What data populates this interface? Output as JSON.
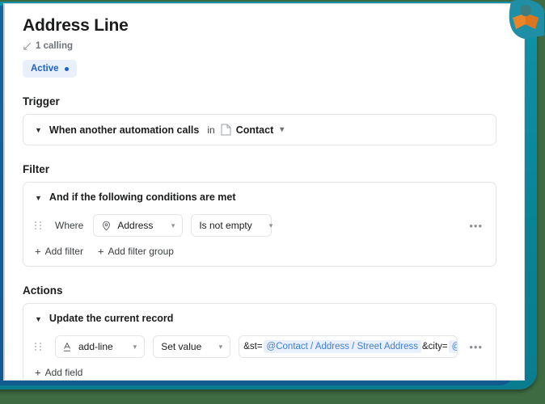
{
  "window": {
    "outer_bg": "#3e6b42",
    "frame_color": "#0b8296",
    "card_bg": "#ffffff"
  },
  "logo": {
    "name": "brand-logo",
    "body_color": "#1f8fa6",
    "arms_color": "#e8852a",
    "head_color": "#3c7d80"
  },
  "header": {
    "title": "Address Line",
    "calling_icon": "incoming-call-arrow-icon",
    "calling_text": "1 calling",
    "status_badge": {
      "label": "Active",
      "dot_color": "#1b62c4",
      "bg_color": "#e9f0fb",
      "text_color": "#1b62c4"
    }
  },
  "sections": {
    "trigger": {
      "heading": "Trigger",
      "caret_icon": "caret-down-icon",
      "label": "When another automation calls",
      "connector": "in",
      "record_icon": "document-icon",
      "record_label": "Contact",
      "record_chevron_icon": "chevron-down-icon"
    },
    "filter": {
      "heading": "Filter",
      "caret_icon": "caret-down-icon",
      "label": "And if the following conditions are met",
      "condition": {
        "drag_icon": "drag-handle-icon",
        "where_label": "Where",
        "field_icon": "map-pin-icon",
        "field_value": "Address",
        "field_chevron_icon": "chevron-down-icon",
        "operator_value": "Is not empty",
        "operator_chevron_icon": "chevron-down-icon",
        "overflow_icon": "more-options-icon",
        "overflow_label": "•••"
      },
      "add_filter_label": "Add filter",
      "add_filter_group_label": "Add filter group",
      "plus_icon": "plus-icon"
    },
    "actions": {
      "heading": "Actions",
      "caret_icon": "caret-down-icon",
      "label": "Update the current record",
      "field_row": {
        "drag_icon": "drag-handle-icon",
        "field_icon": "text-format-icon",
        "field_value": "add-line",
        "field_chevron_icon": "chevron-down-icon",
        "mode_value": "Set value",
        "mode_chevron_icon": "chevron-down-icon",
        "value_parts": [
          {
            "type": "text",
            "text": "&st="
          },
          {
            "type": "chip",
            "text": "@Contact / Address / Street Address"
          },
          {
            "type": "text",
            "text": "&city="
          },
          {
            "type": "chip",
            "text": "@Conta"
          }
        ],
        "overflow_icon": "more-options-icon",
        "overflow_label": "•••"
      },
      "add_field_label": "Add field",
      "plus_icon": "plus-icon"
    }
  }
}
